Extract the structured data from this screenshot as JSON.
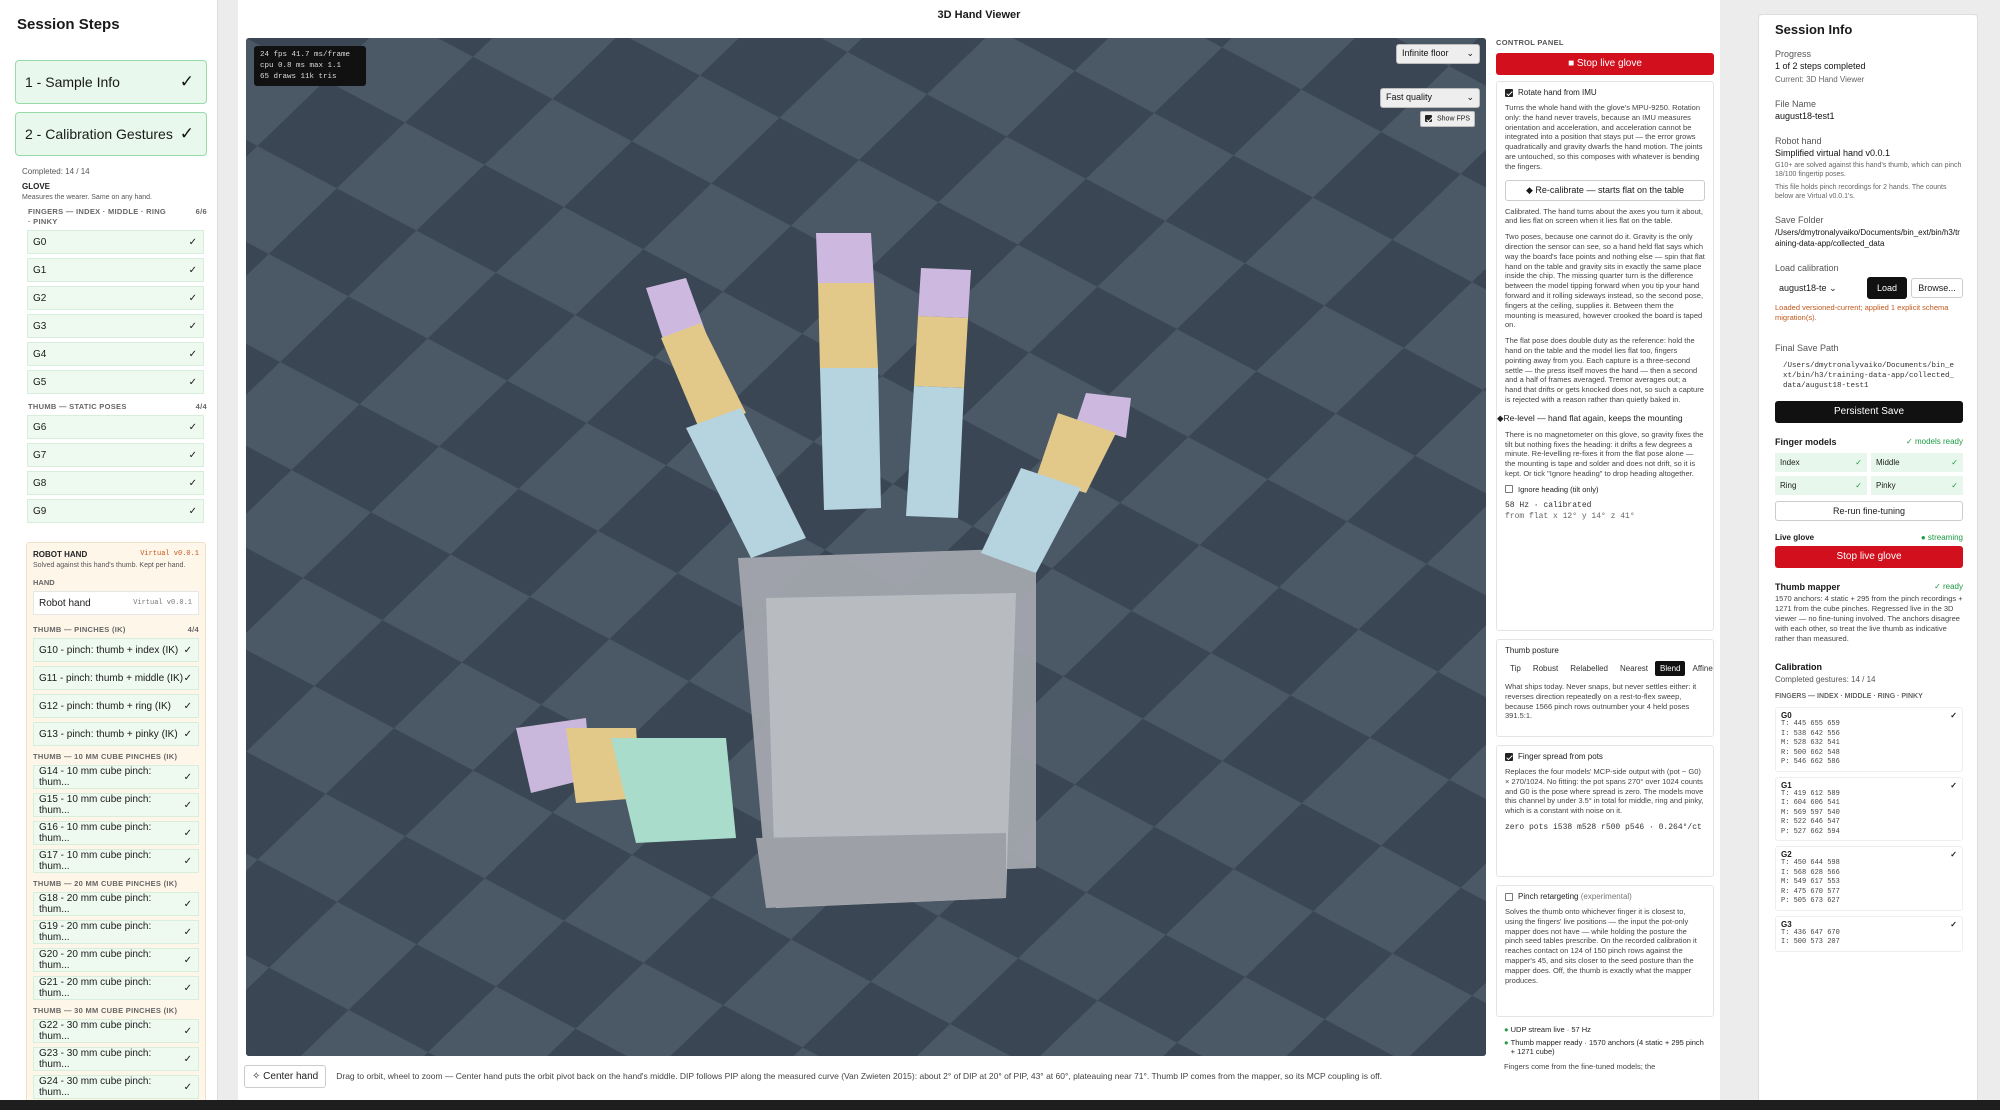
{
  "left": {
    "title": "Session Steps",
    "steps": [
      {
        "label": "1 - Sample Info",
        "check": "✓"
      },
      {
        "label": "2 - Calibration Gestures",
        "check": "✓"
      }
    ],
    "completed": "Completed: 14 / 14",
    "glove_title": "GLOVE",
    "glove_desc": "Measures the wearer. Same on any hand.",
    "fingers_caption": "FINGERS — INDEX · MIDDLE · RING · PINKY",
    "fingers_count": "6/6",
    "finger_gestures": [
      "G0",
      "G1",
      "G2",
      "G3",
      "G4",
      "G5"
    ],
    "thumb_static_caption": "THUMB — STATIC POSES",
    "thumb_static_count": "4/4",
    "thumb_static": [
      "G6",
      "G7",
      "G8",
      "G9"
    ],
    "robot_title": "ROBOT HAND",
    "robot_version": "Virtual v0.0.1",
    "robot_desc": "Solved against this hand's thumb. Kept per hand.",
    "hand_caption": "HAND",
    "hand_value": "Robot hand",
    "hand_value_version": "Virtual v0.0.1",
    "pinch_caption": "THUMB — PINCHES (IK)",
    "pinch_count": "4/4",
    "pinches": [
      "G10 - pinch: thumb + index (IK)",
      "G11 - pinch: thumb + middle (IK)",
      "G12 - pinch: thumb + ring (IK)",
      "G13 - pinch: thumb + pinky (IK)"
    ],
    "cube10_caption": "THUMB — 10 MM CUBE PINCHES (IK)",
    "cube10": [
      "G14 - 10 mm cube pinch: thum...",
      "G15 - 10 mm cube pinch: thum...",
      "G16 - 10 mm cube pinch: thum...",
      "G17 - 10 mm cube pinch: thum..."
    ],
    "cube20_caption": "THUMB — 20 MM CUBE PINCHES (IK)",
    "cube20": [
      "G18 - 20 mm cube pinch: thum...",
      "G19 - 20 mm cube pinch: thum...",
      "G20 - 20 mm cube pinch: thum...",
      "G21 - 20 mm cube pinch: thum..."
    ],
    "cube30_caption": "THUMB — 30 MM CUBE PINCHES (IK)",
    "cube30": [
      "G22 - 30 mm cube pinch: thum...",
      "G23 - 30 mm cube pinch: thum...",
      "G24 - 30 mm cube pinch: thum..."
    ],
    "check": "✓"
  },
  "viewer": {
    "title": "3D Hand Viewer",
    "fps_lines": [
      "24 fps  41.7 ms/frame",
      "cpu 0.8 ms  max 1.1",
      "65 draws  11k tris"
    ],
    "floor_select": "Infinite floor",
    "quality_select": "Fast quality",
    "show_fps": "Show FPS",
    "center_hand": "Center hand",
    "hint": "Drag to orbit, wheel to zoom — Center hand puts the orbit pivot back on the hand's middle. DIP follows PIP along the measured curve (Van Zwieten 2015): about 2° of DIP at 20° of PIP, 43° at 60°, plateauing near 71°. Thumb IP comes from the mapper, so its MCP coupling is off."
  },
  "control": {
    "caption": "CONTROL PANEL",
    "stop_btn": "Stop live glove",
    "imu_label": "Rotate hand from IMU",
    "imu_text": "Turns the whole hand with the glove's MPU-9250. Rotation only: the hand never travels, because an IMU measures orientation and acceleration, and acceleration cannot be integrated into a position that stays put — the error grows quadratically and gravity dwarfs the hand motion. The joints are untouched, so this composes with whatever is bending the fingers.",
    "recal_btn": "Re-calibrate — starts flat on the table",
    "calibrated_text": "Calibrated. The hand turns about the axes you turn it about, and lies flat on screen when it lies flat on the table.",
    "two_poses_text": "Two poses, because one cannot do it. Gravity is the only direction the sensor can see, so a hand held flat says which way the board's face points and nothing else — spin that flat hand on the table and gravity sits in exactly the same place inside the chip. The missing quarter turn is the difference between the model tipping forward when you tip your hand forward and it rolling sideways instead, so the second pose, fingers at the ceiling, supplies it. Between them the mounting is measured, however crooked the board is taped on.",
    "flat_pose_text": "The flat pose does double duty as the reference: hold the hand on the table and the model lies flat too, fingers pointing away from you. Each capture is a three-second settle — the press itself moves the hand — then a second and a half of frames averaged. Tremor averages out; a hand that drifts or gets knocked does not, so such a capture is rejected with a reason rather than quietly baked in.",
    "relevel_btn": "Re-level — hand flat again, keeps the mounting",
    "relevel_text": "There is no magnetometer on this glove, so gravity fixes the tilt but nothing fixes the heading: it drifts a few degrees a minute. Re-levelling re-fixes it from the flat pose alone — the mounting is tape and solder and does not drift, so it is kept. Or tick \"Ignore heading\" to drop heading altogether.",
    "ignore_heading": "Ignore heading (tilt only)",
    "hz": "58 Hz · calibrated",
    "from_flat": "from flat x 12° y 14° z 41°",
    "thumb_posture": "Thumb posture",
    "posture_opts": [
      "Tip",
      "Robust",
      "Relabelled",
      "Nearest",
      "Blend",
      "Affine"
    ],
    "posture_text": "What ships today. Never snaps, but never settles either: it reverses direction repeatedly on a rest-to-flex sweep, because 1566 pinch rows outnumber your 4 held poses 391.5:1.",
    "spread_label": "Finger spread from pots",
    "spread_text": "Replaces the four models' MCP-side output with (pot − G0) × 270/1024. No fitting: the pot spans 270° over 1024 counts and G0 is the pose where spread is zero. The models move this channel by under 3.5° in total for middle, ring and pinky, which is a constant with noise on it.",
    "zero_pots": "zero pots i538 m528 r500 p546 · 0.264°/ct",
    "pinch_label": "Pinch retargeting",
    "pinch_exp": "(experimental)",
    "pinch_text": "Solves the thumb onto whichever finger it is closest to, using the fingers' live positions — the input the pot-only mapper does not have — while holding the posture the pinch seed tables prescribe. On the recorded calibration it reaches contact on 124 of 150 pinch rows against the mapper's 45, and sits closer to the seed posture than the mapper does. Off, the thumb is exactly what the mapper produces.",
    "udp": "UDP stream live · 57 Hz",
    "mapper_ready": "Thumb mapper ready · 1570 anchors (4 static + 295 pinch + 1271 cube)",
    "fingers_come": "Fingers come from the fine-tuned models; the"
  },
  "right": {
    "title": "Session Info",
    "progress_label": "Progress",
    "progress_value": "1 of 2 steps completed",
    "progress_sub": "Current: 3D Hand Viewer",
    "file_label": "File Name",
    "file_value": "august18-test1",
    "robot_label": "Robot hand",
    "robot_value": "Simplified virtual hand v0.0.1",
    "robot_desc1": "G10+ are solved against this hand's thumb, which can pinch 18/100 fingertip poses.",
    "robot_desc2": "This file holds pinch recordings for 2 hands. The counts below are Virtual v0.0.1's.",
    "save_label": "Save Folder",
    "save_value": "/Users/dmytronalyvaiko/Documents/bin_ext/bin/h3/training-data-app/collected_data",
    "load_label": "Load calibration",
    "load_select": "august18-te",
    "load_btn": "Load",
    "browse_btn": "Browse...",
    "load_msg": "Loaded versioned-current; applied 1 explicit schema migration(s).",
    "final_label": "Final Save Path",
    "final_value": "/Users/dmytronalyvaiko/Documents/bin_ext/bin/h3/training-data-app/collected_data/august18-test1",
    "persist_btn": "Persistent Save",
    "fm_label": "Finger models",
    "fm_status": "✓ models ready",
    "fm_items": [
      "Index",
      "Middle",
      "Ring",
      "Pinky"
    ],
    "rerun_btn": "Re-run fine-tuning",
    "live_label": "Live glove",
    "live_status": "● streaming",
    "stop_btn": "Stop live glove",
    "mapper_label": "Thumb mapper",
    "mapper_status": "✓ ready",
    "mapper_text": "1570 anchors: 4 static + 295 from the pinch recordings + 1271 from the cube pinches. Regressed live in the 3D viewer — no fine-tuning involved. The anchors disagree with each other, so treat the live thumb as indicative rather than measured.",
    "cal_label": "Calibration",
    "cal_sub": "Completed gestures: 14 / 14",
    "cal_caption": "FINGERS — INDEX · MIDDLE · RING · PINKY",
    "cal_blocks": [
      {
        "g": "G0",
        "rows": [
          "T: 445 655 659",
          "I: 538 642 556",
          "M: 528 632 541",
          "R: 500 662 548",
          "P: 546 662 586"
        ]
      },
      {
        "g": "G1",
        "rows": [
          "T: 419 612 589",
          "I: 604 606 541",
          "M: 569 597 540",
          "R: 522 646 547",
          "P: 527 662 594"
        ]
      },
      {
        "g": "G2",
        "rows": [
          "T: 450 644 598",
          "I: 568 628 566",
          "M: 549 617 553",
          "R: 475 670 577",
          "P: 505 673 627"
        ]
      },
      {
        "g": "G3",
        "rows": [
          "T: 436 647 670",
          "I: 500 573 207"
        ]
      }
    ],
    "check": "✓"
  }
}
